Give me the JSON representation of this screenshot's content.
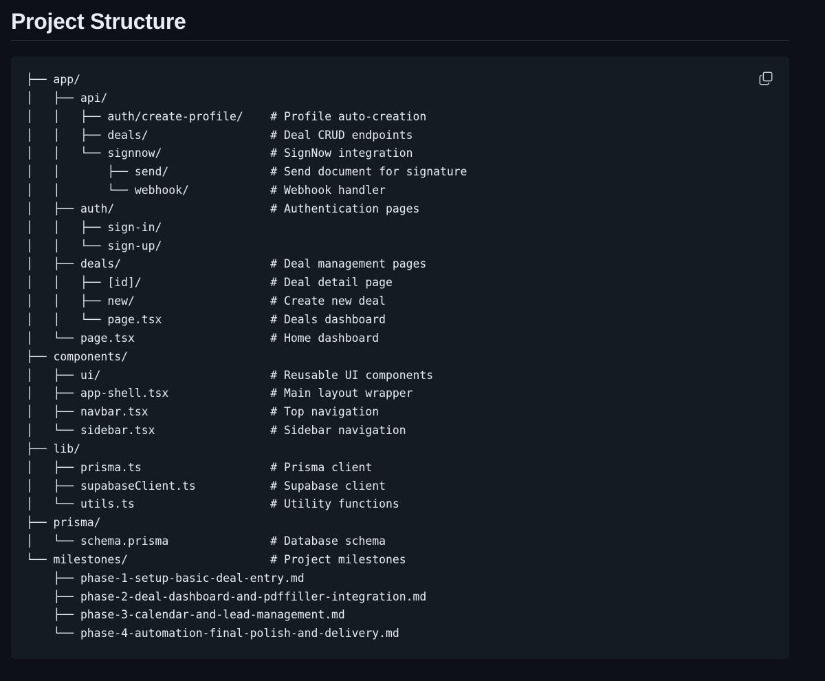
{
  "heading": "Project Structure",
  "copy_icon": "copy-icon",
  "tree_lines": [
    "├── app/",
    "│   ├── api/",
    "│   │   ├── auth/create-profile/    # Profile auto-creation",
    "│   │   ├── deals/                  # Deal CRUD endpoints",
    "│   │   └── signnow/                # SignNow integration",
    "│   │       ├── send/               # Send document for signature",
    "│   │       └── webhook/            # Webhook handler",
    "│   ├── auth/                       # Authentication pages",
    "│   │   ├── sign-in/",
    "│   │   └── sign-up/",
    "│   ├── deals/                      # Deal management pages",
    "│   │   ├── [id]/                   # Deal detail page",
    "│   │   ├── new/                    # Create new deal",
    "│   │   └── page.tsx                # Deals dashboard",
    "│   └── page.tsx                    # Home dashboard",
    "├── components/",
    "│   ├── ui/                         # Reusable UI components",
    "│   ├── app-shell.tsx               # Main layout wrapper",
    "│   ├── navbar.tsx                  # Top navigation",
    "│   └── sidebar.tsx                 # Sidebar navigation",
    "├── lib/",
    "│   ├── prisma.ts                   # Prisma client",
    "│   ├── supabaseClient.ts           # Supabase client",
    "│   └── utils.ts                    # Utility functions",
    "├── prisma/",
    "│   └── schema.prisma               # Database schema",
    "└── milestones/                     # Project milestones",
    "    ├── phase-1-setup-basic-deal-entry.md",
    "    ├── phase-2-deal-dashboard-and-pdffiller-integration.md",
    "    ├── phase-3-calendar-and-lead-management.md",
    "    └── phase-4-automation-final-polish-and-delivery.md"
  ]
}
